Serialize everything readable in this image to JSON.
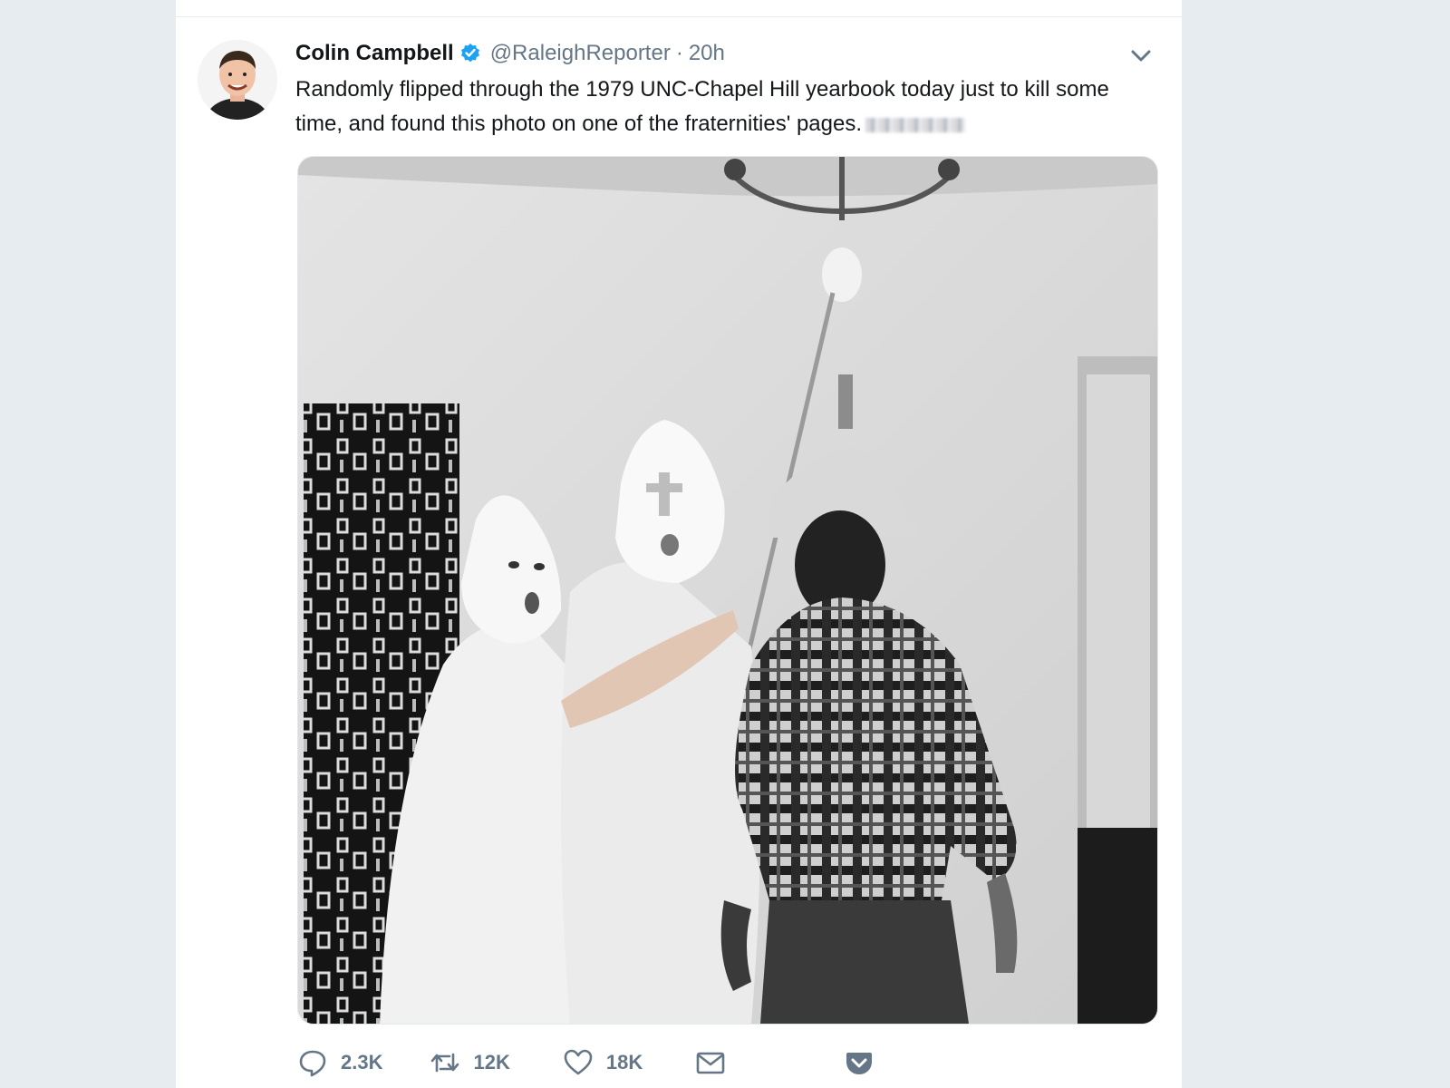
{
  "tweet": {
    "display_name": "Colin Campbell",
    "handle": "@RaleighReporter",
    "separator": "·",
    "time": "20h",
    "text": "Randomly flipped through the 1979 UNC-Chapel Hill yearbook today just to kill some time, and found this photo on one of the fraternities' pages.",
    "verified_icon": "verified-badge-icon",
    "menu_icon": "chevron-down-icon"
  },
  "actions": {
    "reply": {
      "icon": "reply-icon",
      "count": "2.3K"
    },
    "retweet": {
      "icon": "retweet-icon",
      "count": "12K"
    },
    "like": {
      "icon": "heart-icon",
      "count": "18K"
    },
    "dm": {
      "icon": "envelope-icon"
    },
    "pocket": {
      "icon": "pocket-icon"
    }
  },
  "colors": {
    "background": "#e6ecf0",
    "card": "#ffffff",
    "verified_blue": "#1da1f2",
    "secondary_text": "#657786",
    "primary_text": "#14171a",
    "pocket_red": "#ef4056"
  }
}
